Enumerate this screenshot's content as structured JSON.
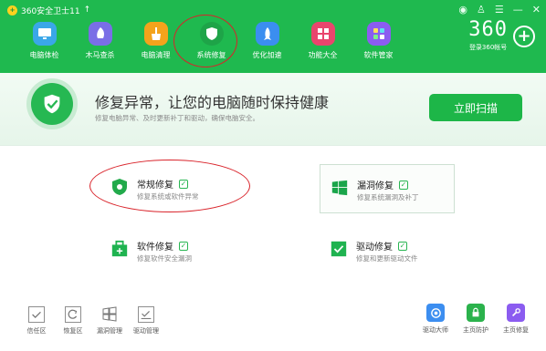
{
  "app": {
    "title": "360安全卫士11",
    "title_suffix": "↑",
    "brand_logo": "360",
    "brand_sub": "登录360帐号"
  },
  "window_controls": [
    "mini-icon",
    "shirt-icon",
    "menu-icon",
    "minimize-icon",
    "close-icon"
  ],
  "nav": [
    {
      "label": "电脑体检",
      "icon": "monitor-icon",
      "color": "#3aa7e8"
    },
    {
      "label": "木马查杀",
      "icon": "horse-icon",
      "color": "#7a6ee6"
    },
    {
      "label": "电脑清理",
      "icon": "broom-icon",
      "color": "#f4a31c"
    },
    {
      "label": "系统修复",
      "icon": "shield-icon",
      "color": "#1ea448",
      "active": true
    },
    {
      "label": "优化加速",
      "icon": "rocket-icon",
      "color": "#3b8ef0"
    },
    {
      "label": "功能大全",
      "icon": "grid-icon",
      "color": "#e9456d"
    },
    {
      "label": "软件管家",
      "icon": "apps-icon",
      "color": "#8b5cf0"
    }
  ],
  "banner": {
    "headline": "修复异常，让您的电脑随时保持健康",
    "sub": "修复电脑异常、及时更新补丁和驱动，确保电脑安全。",
    "button": "立即扫描"
  },
  "cards": [
    {
      "title": "常规修复",
      "desc": "修复系统或软件异常",
      "icon": "shield-repair-icon",
      "checked": true
    },
    {
      "title": "漏洞修复",
      "desc": "修复系统漏洞及补丁",
      "icon": "windows-icon",
      "checked": true
    },
    {
      "title": "软件修复",
      "desc": "修复软件安全漏洞",
      "icon": "software-box-icon",
      "checked": true
    },
    {
      "title": "驱动修复",
      "desc": "修复和更新驱动文件",
      "icon": "driver-icon",
      "checked": true
    }
  ],
  "checkmark": "✓",
  "tools": [
    {
      "label": "信任区",
      "icon": "trust-zone-icon"
    },
    {
      "label": "恢复区",
      "icon": "restore-zone-icon"
    },
    {
      "label": "漏洞管理",
      "icon": "vulnerability-manage-icon"
    },
    {
      "label": "驱动管理",
      "icon": "driver-manage-icon"
    }
  ],
  "right_tools": [
    {
      "label": "驱动大师",
      "icon": "driver-master-icon",
      "color": "#3c8ef0"
    },
    {
      "label": "主页防护",
      "icon": "homepage-protect-icon",
      "color": "#2bb24c"
    },
    {
      "label": "主页修复",
      "icon": "homepage-repair-icon",
      "color": "#8b5cf0"
    }
  ]
}
